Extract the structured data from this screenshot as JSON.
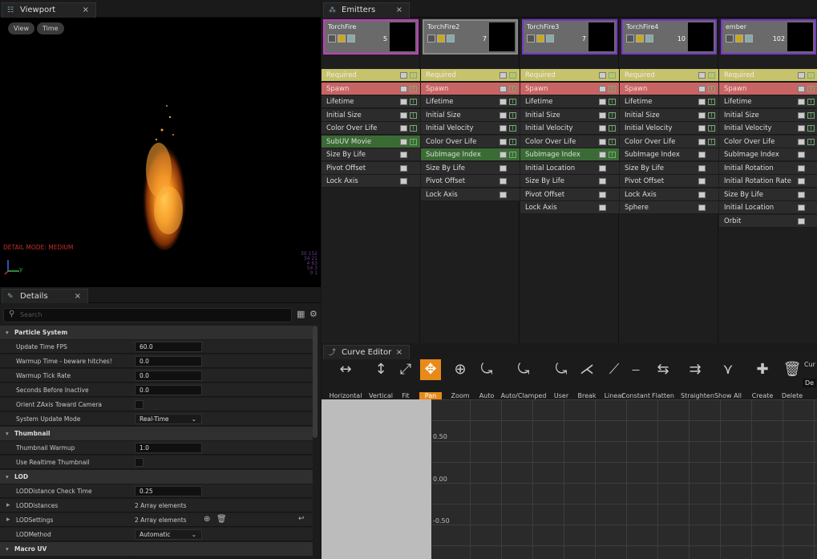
{
  "viewport": {
    "tab_title": "Viewport",
    "btn_view": "View",
    "btn_time": "Time",
    "detail_mode": "DETAIL MODE: MEDIUM",
    "axis_y": "y",
    "stats": [
      "30 152",
      "34 21",
      "4 63",
      "54 3",
      "0 1"
    ]
  },
  "emitters": {
    "tab_title": "Emitters",
    "columns": [
      {
        "name": "TorchFire",
        "count": "5",
        "modules": [
          {
            "label": "Required",
            "kind": "req"
          },
          {
            "label": "Spawn",
            "kind": "spawn"
          },
          {
            "label": "Lifetime",
            "kind": "norm"
          },
          {
            "label": "Initial Size",
            "kind": "norm"
          },
          {
            "label": "Color Over Life",
            "kind": "norm"
          },
          {
            "label": "SubUV Movie",
            "kind": "green"
          },
          {
            "label": "Size By Life",
            "kind": "norm"
          },
          {
            "label": "Pivot Offset",
            "kind": "norm"
          },
          {
            "label": "Lock Axis",
            "kind": "norm"
          }
        ]
      },
      {
        "name": "TorchFire2",
        "count": "7",
        "modules": [
          {
            "label": "Required",
            "kind": "req"
          },
          {
            "label": "Spawn",
            "kind": "spawn"
          },
          {
            "label": "Lifetime",
            "kind": "norm"
          },
          {
            "label": "Initial Size",
            "kind": "norm"
          },
          {
            "label": "Initial Velocity",
            "kind": "norm"
          },
          {
            "label": "Color Over Life",
            "kind": "norm"
          },
          {
            "label": "SubImage Index",
            "kind": "green"
          },
          {
            "label": "Size By Life",
            "kind": "norm"
          },
          {
            "label": "Pivot Offset",
            "kind": "norm"
          },
          {
            "label": "Lock Axis",
            "kind": "norm"
          }
        ]
      },
      {
        "name": "TorchFire3",
        "count": "7",
        "modules": [
          {
            "label": "Required",
            "kind": "req"
          },
          {
            "label": "Spawn",
            "kind": "spawn"
          },
          {
            "label": "Lifetime",
            "kind": "norm"
          },
          {
            "label": "Initial Size",
            "kind": "norm"
          },
          {
            "label": "Initial Velocity",
            "kind": "norm"
          },
          {
            "label": "Color Over Life",
            "kind": "norm"
          },
          {
            "label": "SubImage Index",
            "kind": "green"
          },
          {
            "label": "Initial Location",
            "kind": "norm"
          },
          {
            "label": "Size By Life",
            "kind": "norm"
          },
          {
            "label": "Pivot Offset",
            "kind": "norm"
          },
          {
            "label": "Lock Axis",
            "kind": "norm"
          }
        ]
      },
      {
        "name": "TorchFire4",
        "count": "10",
        "modules": [
          {
            "label": "Required",
            "kind": "req"
          },
          {
            "label": "Spawn",
            "kind": "spawn"
          },
          {
            "label": "Lifetime",
            "kind": "norm"
          },
          {
            "label": "Initial Size",
            "kind": "norm"
          },
          {
            "label": "Initial Velocity",
            "kind": "norm"
          },
          {
            "label": "Color Over Life",
            "kind": "norm"
          },
          {
            "label": "SubImage Index",
            "kind": "norm"
          },
          {
            "label": "Size By Life",
            "kind": "norm"
          },
          {
            "label": "Pivot Offset",
            "kind": "norm"
          },
          {
            "label": "Lock Axis",
            "kind": "norm"
          },
          {
            "label": "Sphere",
            "kind": "norm"
          }
        ]
      },
      {
        "name": "ember",
        "count": "102",
        "modules": [
          {
            "label": "Required",
            "kind": "req"
          },
          {
            "label": "Spawn",
            "kind": "spawn"
          },
          {
            "label": "Lifetime",
            "kind": "norm"
          },
          {
            "label": "Initial Size",
            "kind": "norm"
          },
          {
            "label": "Initial Velocity",
            "kind": "norm"
          },
          {
            "label": "Color Over Life",
            "kind": "norm"
          },
          {
            "label": "SubImage Index",
            "kind": "norm"
          },
          {
            "label": "Initial Rotation",
            "kind": "norm"
          },
          {
            "label": "Initial Rotation Rate",
            "kind": "norm"
          },
          {
            "label": "Size By Life",
            "kind": "norm"
          },
          {
            "label": "Initial Location",
            "kind": "norm"
          },
          {
            "label": "Orbit",
            "kind": "norm"
          }
        ]
      }
    ]
  },
  "details": {
    "tab_title": "Details",
    "search_placeholder": "Search",
    "sections": {
      "particle_system": "Particle System",
      "thumbnail": "Thumbnail",
      "lod": "LOD",
      "macro_uv": "Macro UV"
    },
    "rows": {
      "update_time_fps": {
        "label": "Update Time FPS",
        "value": "60.0"
      },
      "warmup_time": {
        "label": "Warmup Time - beware hitches!",
        "value": "0.0"
      },
      "warmup_tick_rate": {
        "label": "Warmup Tick Rate",
        "value": "0.0"
      },
      "seconds_before_inactive": {
        "label": "Seconds Before Inactive",
        "value": "0.0"
      },
      "orient_zaxis": {
        "label": "Orient ZAxis Toward Camera"
      },
      "system_update_mode": {
        "label": "System Update Mode",
        "value": "Real-Time"
      },
      "thumbnail_warmup": {
        "label": "Thumbnail Warmup",
        "value": "1.0"
      },
      "use_realtime_thumbnail": {
        "label": "Use Realtime Thumbnail"
      },
      "lod_distance_check_time": {
        "label": "LODDistance Check Time",
        "value": "0.25"
      },
      "lod_distances": {
        "label": "LODDistances",
        "value": "2 Array elements"
      },
      "lod_settings": {
        "label": "LODSettings",
        "value": "2 Array elements"
      },
      "lod_method": {
        "label": "LODMethod",
        "value": "Automatic"
      }
    }
  },
  "curve_editor": {
    "tab_title": "Curve Editor",
    "tools": [
      "Horizontal",
      "Vertical",
      "Fit",
      "Pan",
      "Zoom",
      "Auto",
      "Auto/Clamped",
      "User",
      "Break",
      "Linear",
      "Constant",
      "Flatten",
      "Straighten",
      "Show All",
      "Create",
      "Delete"
    ],
    "extra_label_top": "Cur",
    "extra_label_mid": "De",
    "y_labels": [
      "0.50",
      "0.00",
      "-0.50"
    ],
    "active_tool_color": "#e88a1a"
  }
}
